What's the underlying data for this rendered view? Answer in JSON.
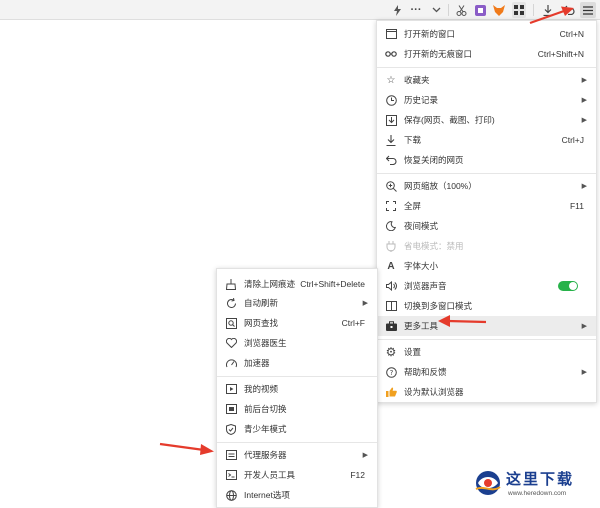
{
  "toolbar": {
    "icons": [
      "lightning-icon",
      "more-icon",
      "chevron-down-icon",
      "scissors-icon",
      "app-icon",
      "fox-icon",
      "grid-icon",
      "download-icon",
      "undo-icon",
      "menu-icon"
    ],
    "more_label": "···"
  },
  "main_menu": {
    "items": [
      {
        "icon": "window-icon",
        "label": "打开新的窗口",
        "shortcut": "Ctrl+N"
      },
      {
        "icon": "incognito-icon",
        "label": "打开新的无痕窗口",
        "shortcut": "Ctrl+Shift+N"
      },
      {
        "icon": "star-icon",
        "label": "收藏夹",
        "submenu": true
      },
      {
        "icon": "clock-icon",
        "label": "历史记录",
        "submenu": true
      },
      {
        "icon": "save-icon",
        "label": "保存(网页、截图、打印)",
        "submenu": true
      },
      {
        "icon": "download-icon",
        "label": "下载",
        "shortcut": "Ctrl+J"
      },
      {
        "icon": "restore-icon",
        "label": "恢复关闭的网页"
      },
      {
        "icon": "zoom-icon",
        "label": "网页缩放（100%）",
        "submenu": true
      },
      {
        "icon": "fullscreen-icon",
        "label": "全屏",
        "shortcut": "F11"
      },
      {
        "icon": "moon-icon",
        "label": "夜间模式"
      },
      {
        "icon": "power-save-icon",
        "label": "省电模式：禁用",
        "disabled": true
      },
      {
        "icon": "font-size-icon",
        "label": "字体大小"
      },
      {
        "icon": "sound-icon",
        "label": "浏览器声音",
        "toggle": true
      },
      {
        "icon": "multi-window-icon",
        "label": "切换到多窗口模式"
      },
      {
        "icon": "toolbox-icon",
        "label": "更多工具",
        "submenu": true,
        "active": true
      },
      {
        "icon": "gear-icon",
        "label": "设置"
      },
      {
        "icon": "help-icon",
        "label": "帮助和反馈",
        "submenu": true
      },
      {
        "icon": "thumbs-up-icon",
        "label": "设为默认浏览器"
      }
    ]
  },
  "sub_menu": {
    "items": [
      {
        "icon": "broom-icon",
        "label": "清除上网痕迹",
        "shortcut": "Ctrl+Shift+Delete"
      },
      {
        "icon": "refresh-icon",
        "label": "自动刷新",
        "submenu": true
      },
      {
        "icon": "find-icon",
        "label": "网页查找",
        "shortcut": "Ctrl+F"
      },
      {
        "icon": "doctor-icon",
        "label": "浏览器医生"
      },
      {
        "icon": "speedometer-icon",
        "label": "加速器"
      },
      {
        "icon": "video-icon",
        "label": "我的视频"
      },
      {
        "icon": "switch-icon",
        "label": "前后台切换"
      },
      {
        "icon": "shield-icon",
        "label": "青少年模式"
      },
      {
        "icon": "proxy-icon",
        "label": "代理服务器",
        "submenu": true
      },
      {
        "icon": "dev-tools-icon",
        "label": "开发人员工具",
        "shortcut": "F12"
      },
      {
        "icon": "globe-icon",
        "label": "Internet选项"
      }
    ]
  },
  "watermark": {
    "title": "这里下载",
    "url": "www.heredown.com"
  },
  "colors": {
    "toggle_on": "#27b24a",
    "annotation_arrow": "#e53b2c",
    "active_row": "#ececec"
  }
}
